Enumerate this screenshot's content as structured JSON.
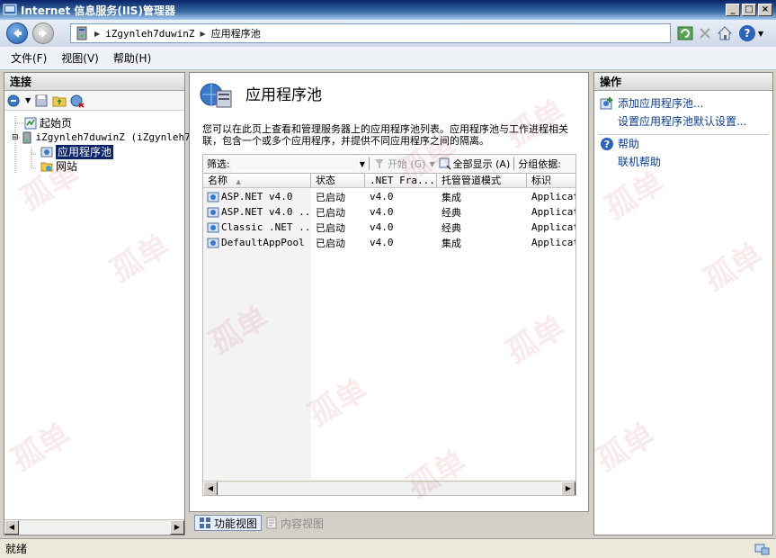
{
  "window": {
    "title": "Internet 信息服务(IIS)管理器",
    "controls": {
      "minimize": "_",
      "maximize": "□",
      "close": "×"
    }
  },
  "address_bar": {
    "segments": [
      "iZgynleh7duwinZ",
      "应用程序池"
    ],
    "separator": "▶",
    "help_label": "?"
  },
  "menu": {
    "items": [
      "文件(F)",
      "视图(V)",
      "帮助(H)"
    ]
  },
  "connections": {
    "title": "连接",
    "tree": [
      {
        "label": "起始页",
        "icon": "start-page-icon"
      },
      {
        "label": "iZgynleh7duwinZ (iZgynleh7",
        "icon": "server-icon",
        "expander": "⊟"
      },
      {
        "label": "应用程序池",
        "icon": "app-pool-icon",
        "selected": true
      },
      {
        "label": "网站",
        "icon": "sites-icon",
        "expander": "⊞"
      }
    ]
  },
  "main": {
    "title": "应用程序池",
    "description": "您可以在此页上查看和管理服务器上的应用程序池列表。应用程序池与工作进程相关联，包含一个或多个应用程序，并提供不同应用程序之间的隔离。",
    "filter": {
      "label": "筛选:",
      "start_label": "开始 (G)",
      "show_all_label": "全部显示 (A)",
      "group_by_label": "分组依据:"
    },
    "table": {
      "columns": [
        "名称",
        "状态",
        ".NET Fra...",
        "托管管道模式",
        "标识"
      ],
      "rows": [
        [
          "ASP.NET v4.0",
          "已启动",
          "v4.0",
          "集成",
          "Applicat"
        ],
        [
          "ASP.NET v4.0 ...",
          "已启动",
          "v4.0",
          "经典",
          "Applicat"
        ],
        [
          "Classic .NET ...",
          "已启动",
          "v4.0",
          "经典",
          "Applicat"
        ],
        [
          "DefaultAppPool",
          "已启动",
          "v4.0",
          "集成",
          "Applicat"
        ]
      ]
    },
    "view_tabs": {
      "features": "功能视图",
      "content": "内容视图"
    }
  },
  "actions": {
    "title": "操作",
    "items": [
      {
        "label": "添加应用程序池...",
        "icon": "add-app-pool-icon"
      },
      {
        "label": "设置应用程序池默认设置..."
      },
      {
        "label": "帮助",
        "icon": "help-icon"
      },
      {
        "label": "联机帮助"
      }
    ]
  },
  "status": {
    "text": "就绪"
  },
  "watermark_text": "孤单"
}
